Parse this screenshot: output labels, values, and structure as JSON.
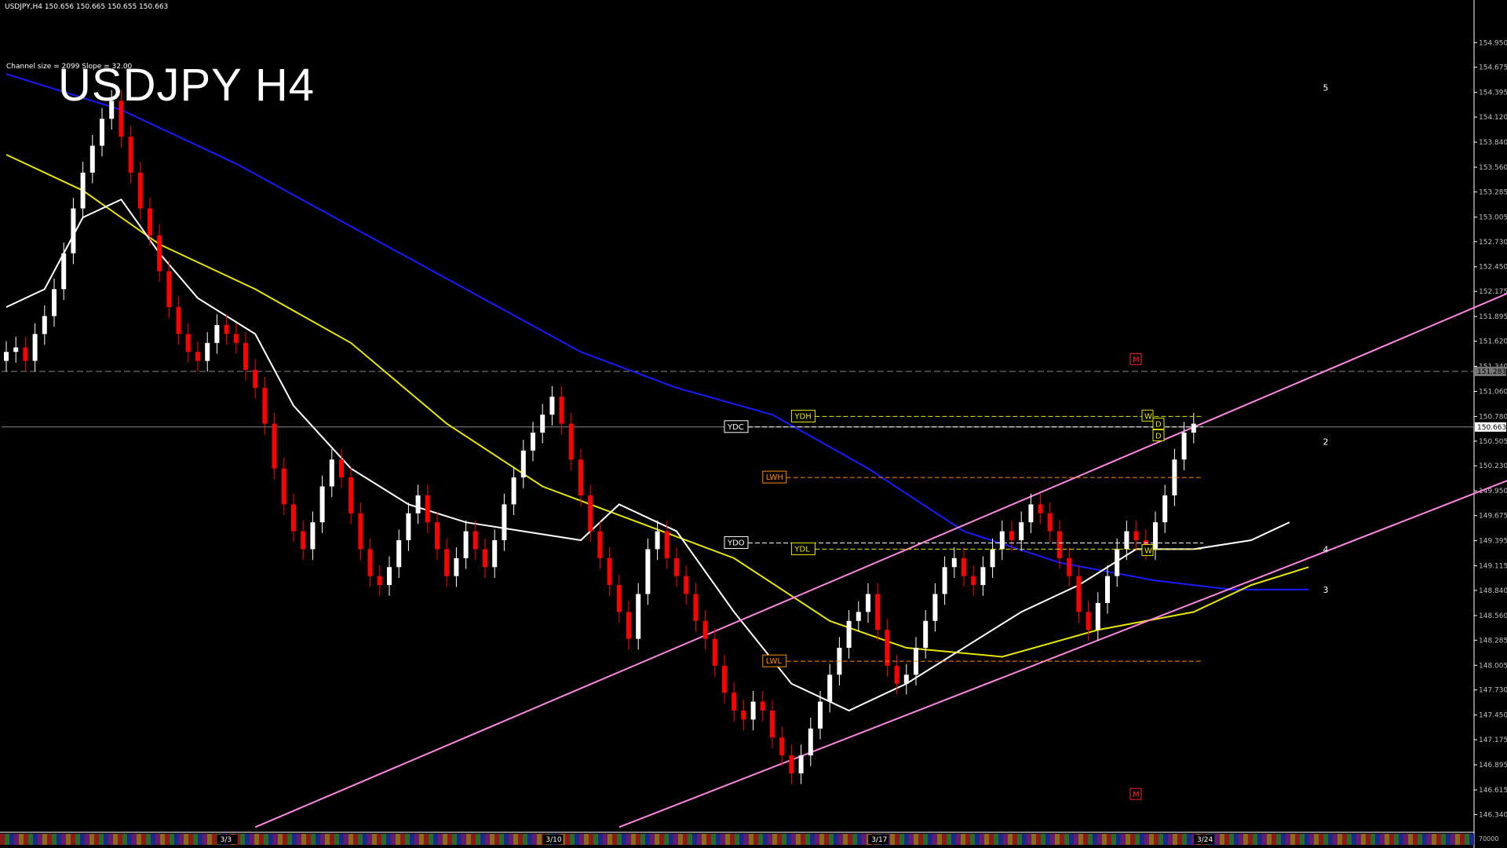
{
  "header": {
    "symbol_line": "USDJPY,H4  150.656 150.665 150.655 150.663",
    "channel_info": "Channel size = 2099 Slope = 32.00",
    "big_title": "USDJPY H4"
  },
  "colors": {
    "background": "#000000",
    "bull_candle": "#ffffff",
    "bear_candle": "#ff0000",
    "ma_blue": "#1a1aff",
    "ma_yellow": "#e6e600",
    "ma_white": "#ffffff",
    "chikou_green": "#1fa31f",
    "channel_pink": "#ff88e0",
    "kumo_red": "#ff2020",
    "kumo_blue": "#3060ff",
    "wave_magenta": "#d020d0",
    "axis_text": "#c0c0c0",
    "bid_box": "#ffffff"
  },
  "chart_data": {
    "type": "candlestick",
    "symbol": "USDJPY",
    "timeframe": "H4",
    "current_price": 150.663,
    "quote": {
      "bid": 150.656,
      "high": 150.665,
      "low": 150.655,
      "close": 150.663
    },
    "y_range": [
      146.16,
      155.32
    ],
    "y_ticks": [
      "154.950",
      "154.675",
      "154.395",
      "154.120",
      "153.840",
      "153.560",
      "153.285",
      "153.005",
      "152.730",
      "152.450",
      "152.175",
      "151.895",
      "151.620",
      "151.340",
      "151.060",
      "150.780",
      "150.505",
      "150.230",
      "149.950",
      "149.675",
      "149.395",
      "149.115",
      "148.840",
      "148.560",
      "148.285",
      "148.005",
      "147.730",
      "147.450",
      "147.175",
      "146.895",
      "146.615",
      "146.340"
    ],
    "y_tick_values": [
      154.95,
      154.675,
      154.395,
      154.12,
      153.84,
      153.56,
      153.285,
      153.005,
      152.73,
      152.45,
      152.175,
      151.895,
      151.62,
      151.34,
      151.06,
      150.78,
      150.505,
      150.23,
      149.95,
      149.675,
      149.395,
      149.115,
      148.84,
      148.56,
      148.285,
      148.005,
      147.73,
      147.45,
      147.175,
      146.895,
      146.615,
      146.34
    ],
    "marked_price_boxes": [
      {
        "label": "151.283",
        "value": 151.283,
        "style": "gray"
      },
      {
        "label": "150.663",
        "value": 150.663,
        "style": "white"
      }
    ],
    "bottom_axis_label": "70000",
    "date_labels": [
      {
        "label": "3/3",
        "index": 23
      },
      {
        "label": "3/10",
        "index": 57
      },
      {
        "label": "3/17",
        "index": 91
      },
      {
        "label": "3/24",
        "index": 125
      }
    ],
    "closes": [
      151.5,
      151.55,
      151.4,
      151.7,
      151.9,
      152.2,
      152.6,
      153.1,
      153.5,
      153.8,
      154.1,
      154.3,
      153.9,
      153.5,
      153.1,
      152.8,
      152.4,
      152.0,
      151.7,
      151.5,
      151.4,
      151.6,
      151.8,
      151.7,
      151.6,
      151.3,
      151.1,
      150.7,
      150.2,
      149.8,
      149.5,
      149.3,
      149.6,
      150.0,
      150.3,
      150.1,
      149.7,
      149.3,
      149.0,
      148.9,
      149.1,
      149.4,
      149.7,
      149.9,
      149.6,
      149.3,
      149.0,
      149.2,
      149.5,
      149.3,
      149.1,
      149.4,
      149.8,
      150.1,
      150.4,
      150.6,
      150.8,
      151.0,
      150.7,
      150.3,
      149.9,
      149.5,
      149.2,
      148.9,
      148.6,
      148.3,
      148.8,
      149.3,
      149.5,
      149.2,
      149.0,
      148.8,
      148.5,
      148.3,
      148.0,
      147.7,
      147.5,
      147.4,
      147.6,
      147.5,
      147.2,
      147.0,
      146.8,
      147.0,
      147.3,
      147.6,
      147.9,
      148.2,
      148.5,
      148.6,
      148.8,
      148.4,
      148.0,
      147.8,
      147.9,
      148.2,
      148.5,
      148.8,
      149.1,
      149.2,
      149.0,
      148.9,
      149.1,
      149.3,
      149.5,
      149.4,
      149.6,
      149.8,
      149.7,
      149.5,
      149.2,
      149.0,
      148.6,
      148.4,
      148.7,
      149.0,
      149.3,
      149.5,
      149.4,
      149.3,
      149.6,
      149.9,
      150.3,
      150.6,
      150.7
    ],
    "candles_description_note": "",
    "moving_averages": [
      {
        "color": "#1a1aff",
        "points": [
          [
            0,
            154.6
          ],
          [
            12,
            154.2
          ],
          [
            24,
            153.6
          ],
          [
            36,
            152.9
          ],
          [
            48,
            152.2
          ],
          [
            60,
            151.5
          ],
          [
            70,
            151.1
          ],
          [
            80,
            150.8
          ],
          [
            90,
            150.2
          ],
          [
            100,
            149.5
          ],
          [
            110,
            149.15
          ],
          [
            120,
            148.95
          ],
          [
            128,
            148.85
          ],
          [
            136,
            148.85
          ]
        ]
      },
      {
        "color": "#e6e600",
        "points": [
          [
            0,
            153.7
          ],
          [
            8,
            153.3
          ],
          [
            16,
            152.7
          ],
          [
            26,
            152.2
          ],
          [
            36,
            151.6
          ],
          [
            46,
            150.7
          ],
          [
            56,
            150.0
          ],
          [
            66,
            149.6
          ],
          [
            76,
            149.2
          ],
          [
            86,
            148.5
          ],
          [
            94,
            148.2
          ],
          [
            104,
            148.1
          ],
          [
            114,
            148.4
          ],
          [
            124,
            148.6
          ],
          [
            130,
            148.9
          ],
          [
            136,
            149.1
          ]
        ]
      },
      {
        "color": "#ffffff",
        "points": [
          [
            0,
            152.0
          ],
          [
            4,
            152.2
          ],
          [
            8,
            153.0
          ],
          [
            12,
            153.2
          ],
          [
            16,
            152.6
          ],
          [
            20,
            152.1
          ],
          [
            26,
            151.7
          ],
          [
            30,
            150.9
          ],
          [
            36,
            150.2
          ],
          [
            42,
            149.8
          ],
          [
            48,
            149.6
          ],
          [
            54,
            149.5
          ],
          [
            60,
            149.4
          ],
          [
            64,
            149.8
          ],
          [
            70,
            149.5
          ],
          [
            76,
            148.6
          ],
          [
            82,
            147.8
          ],
          [
            88,
            147.5
          ],
          [
            94,
            147.8
          ],
          [
            100,
            148.2
          ],
          [
            106,
            148.6
          ],
          [
            112,
            148.9
          ],
          [
            118,
            149.3
          ],
          [
            124,
            149.3
          ],
          [
            130,
            149.4
          ],
          [
            134,
            149.6
          ]
        ]
      }
    ],
    "channel_lines": [
      {
        "color": "#ff88e0",
        "points": [
          [
            26,
            146.2
          ],
          [
            160,
            152.3
          ]
        ]
      },
      {
        "color": "#ff88e0",
        "points": [
          [
            64,
            146.2
          ],
          [
            160,
            150.2
          ]
        ]
      }
    ],
    "wave_labels": [
      {
        "label": "5",
        "value": 154.45,
        "index": 137.5
      },
      {
        "label": "2",
        "value": 150.5,
        "index": 137.5
      },
      {
        "label": "4",
        "value": 149.3,
        "index": 137.5
      },
      {
        "label": "3",
        "value": 148.85,
        "index": 137.5
      }
    ],
    "level_tags": [
      {
        "label": "YDC",
        "value": 150.663,
        "index": 75
      },
      {
        "label": "YDH",
        "value": 150.78,
        "index": 82
      },
      {
        "label": "LWH",
        "value": 150.1,
        "index": 79
      },
      {
        "label": "YDO",
        "value": 149.37,
        "index": 75
      },
      {
        "label": "YDL",
        "value": 149.3,
        "index": 82
      },
      {
        "label": "LWL",
        "value": 148.05,
        "index": 79
      }
    ],
    "right_markers": [
      {
        "label": "M",
        "value": 151.42
      },
      {
        "label": "M",
        "value": 146.57
      },
      {
        "label": "W",
        "value": 150.79
      },
      {
        "label": "D",
        "value": 150.7
      },
      {
        "label": "D",
        "value": 150.57
      },
      {
        "label": "W",
        "value": 149.29
      }
    ]
  }
}
